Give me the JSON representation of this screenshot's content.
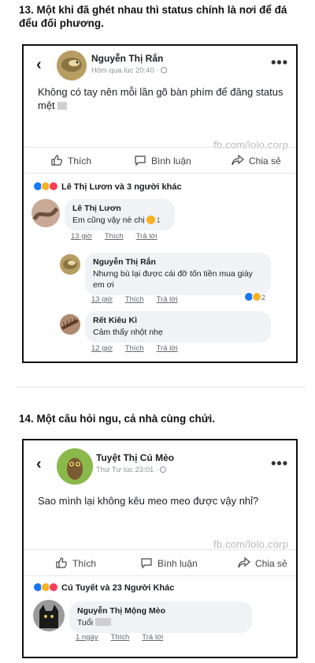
{
  "post1": {
    "heading": "13. Một khi đã ghét nhau thì status chính là nơi để đá đểu đối phương.",
    "poster_name": "Nguyễn Thị Rắn",
    "post_time": "Hôm qua lúc 20:40 ·",
    "post_text": "Không có tay nên mỗi lần gõ bàn phím để đăng status mệt",
    "watermark": "fb.com/lolo.corp",
    "actions": {
      "like": "Thích",
      "comment": "Bình luận",
      "share": "Chia sẻ"
    },
    "reactions_text": "Lê Thị Lươn và 3 người khác",
    "comments": [
      {
        "name": "Lê Thị Lươn",
        "text": "Em cũng vậy nè chị",
        "reaction_count": "1",
        "time": "13 giờ",
        "like": "Thích",
        "reply": "Trả lời"
      },
      {
        "name": "Nguyễn Thị Rắn",
        "text": "Nhưng bù lại được cái đỡ tốn tiền mua giày em ơi",
        "reaction_count": "2",
        "time": "13 giờ",
        "like": "Thích",
        "reply": "Trả lời"
      },
      {
        "name": "Rết Kiêu Kì",
        "text": "Cảm thấy nhột nhẹ",
        "time": "12 giờ",
        "like": "Thích",
        "reply": "Trả lời"
      }
    ]
  },
  "post2": {
    "heading": "14. Một câu hỏi ngu, cả nhà cùng chửi.",
    "poster_name": "Tuyệt Thị Cú Mèo",
    "post_time": "Thứ Tư lúc 23:01 ·",
    "post_text": "Sao mình lại không kêu meo meo được vậy nhỉ?",
    "watermark": "fb.com/lolo.corp",
    "actions": {
      "like": "Thích",
      "comment": "Bình luận",
      "share": "Chia sẻ"
    },
    "reactions_text": "Cú Tuyết và 23 Người Khác",
    "comments": [
      {
        "name": "Nguyễn Thị Mộng Mèo",
        "text": "Tuổi",
        "time": "1 ngày",
        "like": "Thích",
        "reply": "Trả lời"
      }
    ]
  }
}
